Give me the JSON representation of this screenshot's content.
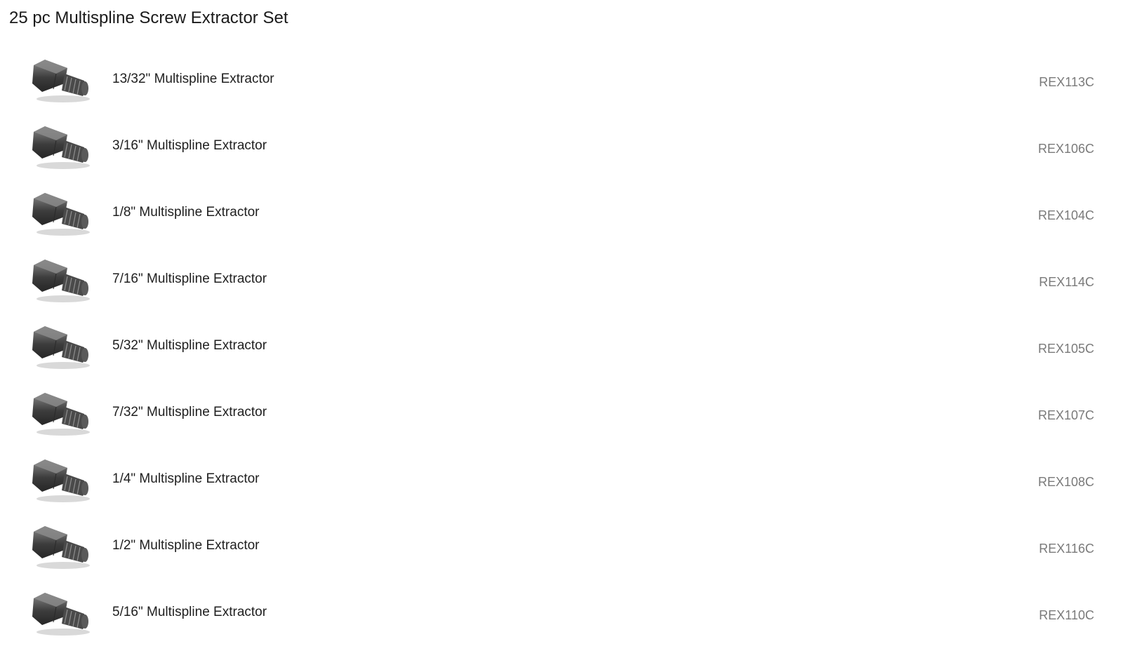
{
  "page": {
    "title": "25 pc Multispline Screw Extractor Set"
  },
  "items": [
    {
      "name": "13/32\" Multispline Extractor",
      "sku": "REX113C",
      "icon": "screw-extractor-icon"
    },
    {
      "name": "3/16\" Multispline Extractor",
      "sku": "REX106C",
      "icon": "screw-extractor-icon"
    },
    {
      "name": "1/8\" Multispline Extractor",
      "sku": "REX104C",
      "icon": "screw-extractor-icon"
    },
    {
      "name": "7/16\" Multispline Extractor",
      "sku": "REX114C",
      "icon": "screw-extractor-icon"
    },
    {
      "name": "5/32\" Multispline Extractor",
      "sku": "REX105C",
      "icon": "screw-extractor-icon"
    },
    {
      "name": "7/32\" Multispline Extractor",
      "sku": "REX107C",
      "icon": "screw-extractor-icon"
    },
    {
      "name": "1/4\" Multispline Extractor",
      "sku": "REX108C",
      "icon": "screw-extractor-icon"
    },
    {
      "name": "1/2\" Multispline Extractor",
      "sku": "REX116C",
      "icon": "screw-extractor-icon"
    },
    {
      "name": "5/16\" Multispline Extractor",
      "sku": "REX110C",
      "icon": "screw-extractor-icon"
    }
  ],
  "colors": {
    "title_text": "#1a1a1a",
    "item_text": "#1f1f1f",
    "sku_text": "#7a7a7a",
    "tool_metal_dark": "#3d3d3d",
    "tool_metal_light": "#8a8a8a"
  }
}
